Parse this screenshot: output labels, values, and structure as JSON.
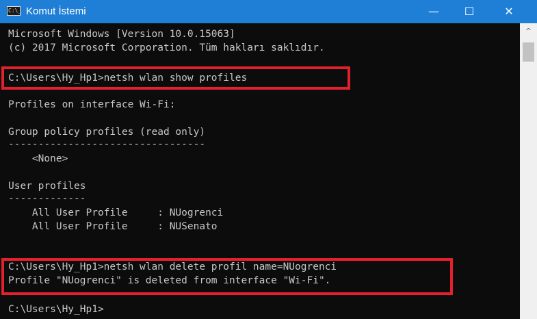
{
  "window": {
    "title": "Komut İstemi",
    "icon_text": "C:\\_",
    "controls": {
      "minimize": "—",
      "maximize": "☐",
      "close": "✕"
    }
  },
  "console": {
    "lines": [
      "Microsoft Windows [Version 10.0.15063]",
      "(c) 2017 Microsoft Corporation. Tüm hakları saklıdır.",
      "",
      "C:\\Users\\Hy_Hp1>netsh wlan show profiles",
      "",
      "Profiles on interface Wi-Fi:",
      "",
      "Group policy profiles (read only)",
      "---------------------------------",
      "    <None>",
      "",
      "User profiles",
      "-------------",
      "    All User Profile     : NUogrenci",
      "    All User Profile     : NUSenato",
      "",
      "",
      "C:\\Users\\Hy_Hp1>netsh wlan delete profil name=NUogrenci",
      "Profile \"NUogrenci\" is deleted from interface \"Wi-Fi\".",
      "",
      "C:\\Users\\Hy_Hp1>"
    ]
  },
  "highlight_color": "#e3202b",
  "scrollbar": {
    "up_arrow": "^"
  }
}
